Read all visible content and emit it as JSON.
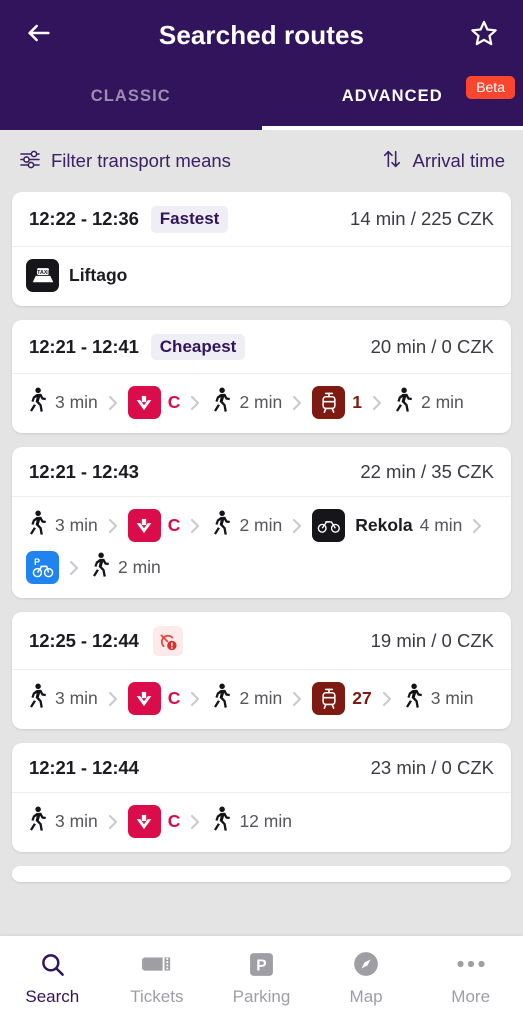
{
  "header": {
    "title": "Searched routes",
    "back_icon": "arrow-left-icon",
    "favorite_icon": "star-outline-icon",
    "tabs": [
      {
        "label": "CLASSIC",
        "active": false
      },
      {
        "label": "ADVANCED",
        "active": true,
        "badge": "Beta"
      }
    ]
  },
  "filter_bar": {
    "filter_label": "Filter transport means",
    "filter_icon": "sliders-icon",
    "sort_label": "Arrival time",
    "sort_icon": "sort-arrows-icon"
  },
  "routes": [
    {
      "time_range": "12:22 - 12:36",
      "badge": "Fastest",
      "summary": "14 min / 225 CZK",
      "legs": [
        {
          "type": "provider",
          "icon": "taxi-icon",
          "tile": "black",
          "name": "Liftago"
        }
      ]
    },
    {
      "time_range": "12:21 - 12:41",
      "badge": "Cheapest",
      "summary": "20 min / 0 CZK",
      "legs": [
        {
          "type": "walk",
          "icon": "walking-icon",
          "text": "3 min"
        },
        {
          "type": "metro",
          "icon": "metro-icon",
          "tile": "metro",
          "line": "C",
          "line_color": "#da0d4a"
        },
        {
          "type": "walk",
          "icon": "walking-icon",
          "text": "2 min"
        },
        {
          "type": "tram",
          "icon": "tram-icon",
          "tile": "tram",
          "line": "1",
          "line_color": "#7e1a12"
        },
        {
          "type": "walk",
          "icon": "walking-icon",
          "text": "2 min"
        }
      ]
    },
    {
      "time_range": "12:21 - 12:43",
      "badge": null,
      "summary": "22 min / 35 CZK",
      "legs": [
        {
          "type": "walk",
          "icon": "walking-icon",
          "text": "3 min"
        },
        {
          "type": "metro",
          "icon": "metro-icon",
          "tile": "metro",
          "line": "C",
          "line_color": "#da0d4a"
        },
        {
          "type": "walk",
          "icon": "walking-icon",
          "text": "2 min"
        },
        {
          "type": "provider",
          "icon": "bicycle-icon",
          "tile": "black",
          "name": "Rekola",
          "text": "4 min"
        },
        {
          "type": "bikepark",
          "icon": "bike-parking-icon",
          "tile": "blue"
        },
        {
          "type": "walk",
          "icon": "walking-icon",
          "text": "2 min"
        }
      ]
    },
    {
      "time_range": "12:25 - 12:44",
      "badge": null,
      "alert_icon": "service-alert-icon",
      "summary": "19 min / 0 CZK",
      "legs": [
        {
          "type": "walk",
          "icon": "walking-icon",
          "text": "3 min"
        },
        {
          "type": "metro",
          "icon": "metro-icon",
          "tile": "metro",
          "line": "C",
          "line_color": "#da0d4a"
        },
        {
          "type": "walk",
          "icon": "walking-icon",
          "text": "2 min"
        },
        {
          "type": "tram",
          "icon": "tram-icon",
          "tile": "tram",
          "line": "27",
          "line_color": "#7e1a12"
        },
        {
          "type": "walk",
          "icon": "walking-icon",
          "text": "3 min"
        }
      ]
    },
    {
      "time_range": "12:21 - 12:44",
      "badge": null,
      "summary": "23 min / 0 CZK",
      "legs": [
        {
          "type": "walk",
          "icon": "walking-icon",
          "text": "3 min"
        },
        {
          "type": "metro",
          "icon": "metro-icon",
          "tile": "metro",
          "line": "C",
          "line_color": "#da0d4a"
        },
        {
          "type": "walk",
          "icon": "walking-icon",
          "text": "12 min"
        }
      ]
    }
  ],
  "bottom_nav": [
    {
      "label": "Search",
      "icon": "search-icon",
      "active": true
    },
    {
      "label": "Tickets",
      "icon": "ticket-icon",
      "active": false
    },
    {
      "label": "Parking",
      "icon": "parking-icon",
      "active": false
    },
    {
      "label": "Map",
      "icon": "compass-icon",
      "active": false
    },
    {
      "label": "More",
      "icon": "ellipsis-icon",
      "active": false
    }
  ],
  "colors": {
    "brand_purple": "#32145c",
    "metro_c": "#da0d4a",
    "tram": "#7e1a12",
    "bike_park_blue": "#1f84ef",
    "beta_red": "#f9462f",
    "page_bg": "#e4e4e4"
  }
}
